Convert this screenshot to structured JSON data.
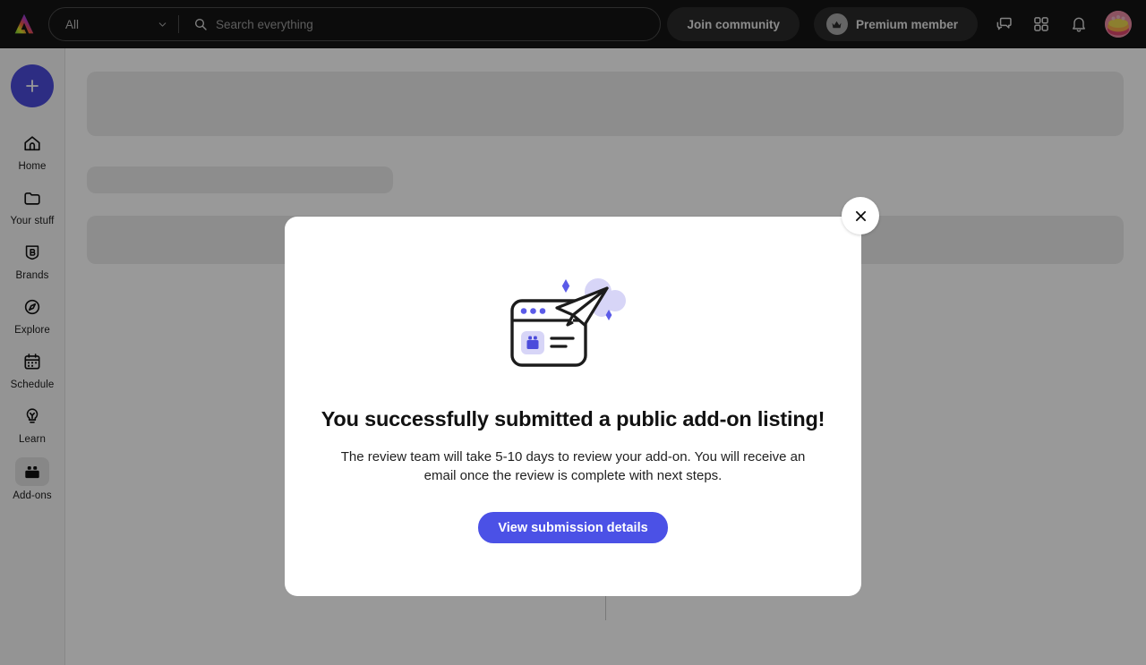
{
  "app": {
    "logo_icon": "rainbow-a-logo",
    "accent_color": "#4b51e6",
    "create_color": "#4b4bdb",
    "topbar_bg": "#141414",
    "overlay_color": "rgba(0,0,0,0.40)"
  },
  "header": {
    "scope_value": "All",
    "scope_chevron_icon": "chevron-down-icon",
    "search_icon": "search-icon",
    "search_placeholder": "Search everything",
    "search_value": "",
    "join_community_label": "Join community",
    "premium_label": "Premium member",
    "premium_badge_icon": "verified-crown-icon",
    "messages_icon": "chat-bubbles-icon",
    "apps_icon": "grid-apps-icon",
    "notifications_icon": "bell-icon",
    "avatar_icon": "user-avatar"
  },
  "sidebar": {
    "create_label": "+",
    "create_icon": "plus-icon",
    "items": [
      {
        "label": "Home",
        "icon": "home-icon",
        "selected": false
      },
      {
        "label": "Your stuff",
        "icon": "folder-icon",
        "selected": false
      },
      {
        "label": "Brands",
        "icon": "brand-b-icon",
        "selected": false
      },
      {
        "label": "Explore",
        "icon": "compass-icon",
        "selected": false
      },
      {
        "label": "Schedule",
        "icon": "calendar-icon",
        "selected": false
      },
      {
        "label": "Learn",
        "icon": "lightbulb-icon",
        "selected": false
      },
      {
        "label": "Add-ons",
        "icon": "addons-icon",
        "selected": true
      }
    ]
  },
  "main": {
    "loading": true,
    "skeleton_blocks": 3
  },
  "modal": {
    "illustration_icon": "paper-plane-submission-illustration",
    "title": "You successfully submitted a public add-on listing!",
    "body": "The review team will take 5-10 days to review your add-on. You will receive an email once the review is complete with next steps.",
    "primary_button_label": "View submission details",
    "close_icon": "close-icon"
  }
}
